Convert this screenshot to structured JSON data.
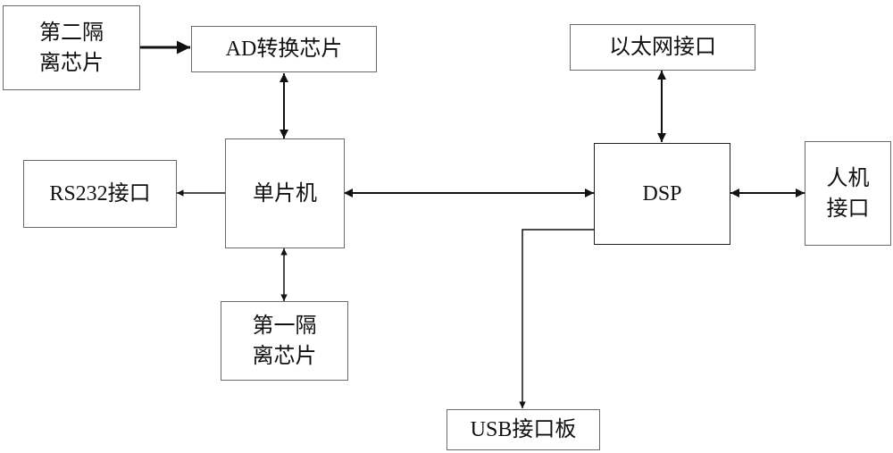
{
  "diagram": {
    "nodes": {
      "isolator2": {
        "line1": "第二隔",
        "line2": "离芯片"
      },
      "ad_chip": {
        "label": "AD转换芯片"
      },
      "rs232": {
        "label": "RS232接口"
      },
      "mcu": {
        "label": "单片机"
      },
      "isolator1": {
        "line1": "第一隔",
        "line2": "离芯片"
      },
      "ethernet": {
        "label": "以太网接口"
      },
      "dsp": {
        "label": "DSP"
      },
      "hmi": {
        "line1": "人机",
        "line2": "接口"
      },
      "usb": {
        "label": "USB接口板"
      }
    },
    "edges": [
      {
        "from": "isolator2",
        "to": "ad_chip",
        "direction": "one-way"
      },
      {
        "from": "ad_chip",
        "to": "mcu",
        "direction": "bidirectional"
      },
      {
        "from": "mcu",
        "to": "rs232",
        "direction": "one-way"
      },
      {
        "from": "mcu",
        "to": "isolator1",
        "direction": "bidirectional"
      },
      {
        "from": "mcu",
        "to": "dsp",
        "direction": "bidirectional"
      },
      {
        "from": "ethernet",
        "to": "dsp",
        "direction": "bidirectional"
      },
      {
        "from": "dsp",
        "to": "hmi",
        "direction": "bidirectional"
      },
      {
        "from": "dsp",
        "to": "usb",
        "direction": "one-way"
      }
    ]
  }
}
